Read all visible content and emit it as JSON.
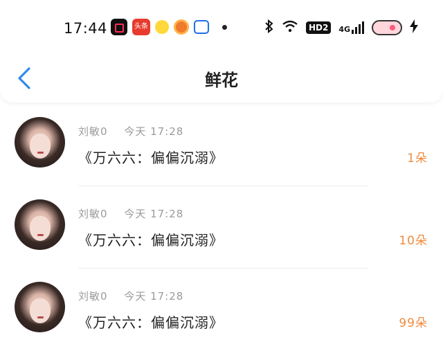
{
  "status_bar": {
    "time": "17:44",
    "notification_icons": [
      "video-app-icon",
      "toutiao-app-icon",
      "emoji-app-icon",
      "pizza-app-icon",
      "shopping-bag-app-icon"
    ],
    "toutiao_label": "头条",
    "system_icons": [
      "bluetooth-icon",
      "wifi-icon",
      "hd-icon",
      "signal-4g-icon",
      "battery-icon",
      "charging-icon"
    ],
    "hd_label": "HD2",
    "network_label": "4G"
  },
  "nav": {
    "back_icon": "chevron-left-icon",
    "title": "鲜花"
  },
  "colors": {
    "accent_blue": "#2f8bea",
    "count_orange": "#f08a3c",
    "meta_gray": "#9a9a9a"
  },
  "items": [
    {
      "name": "刘敏0",
      "time": "今天 17:28",
      "title": "《万六六：偏偏沉溺》",
      "count": "1朵"
    },
    {
      "name": "刘敏0",
      "time": "今天 17:28",
      "title": "《万六六：偏偏沉溺》",
      "count": "10朵"
    },
    {
      "name": "刘敏0",
      "time": "今天 17:28",
      "title": "《万六六：偏偏沉溺》",
      "count": "99朵"
    }
  ]
}
